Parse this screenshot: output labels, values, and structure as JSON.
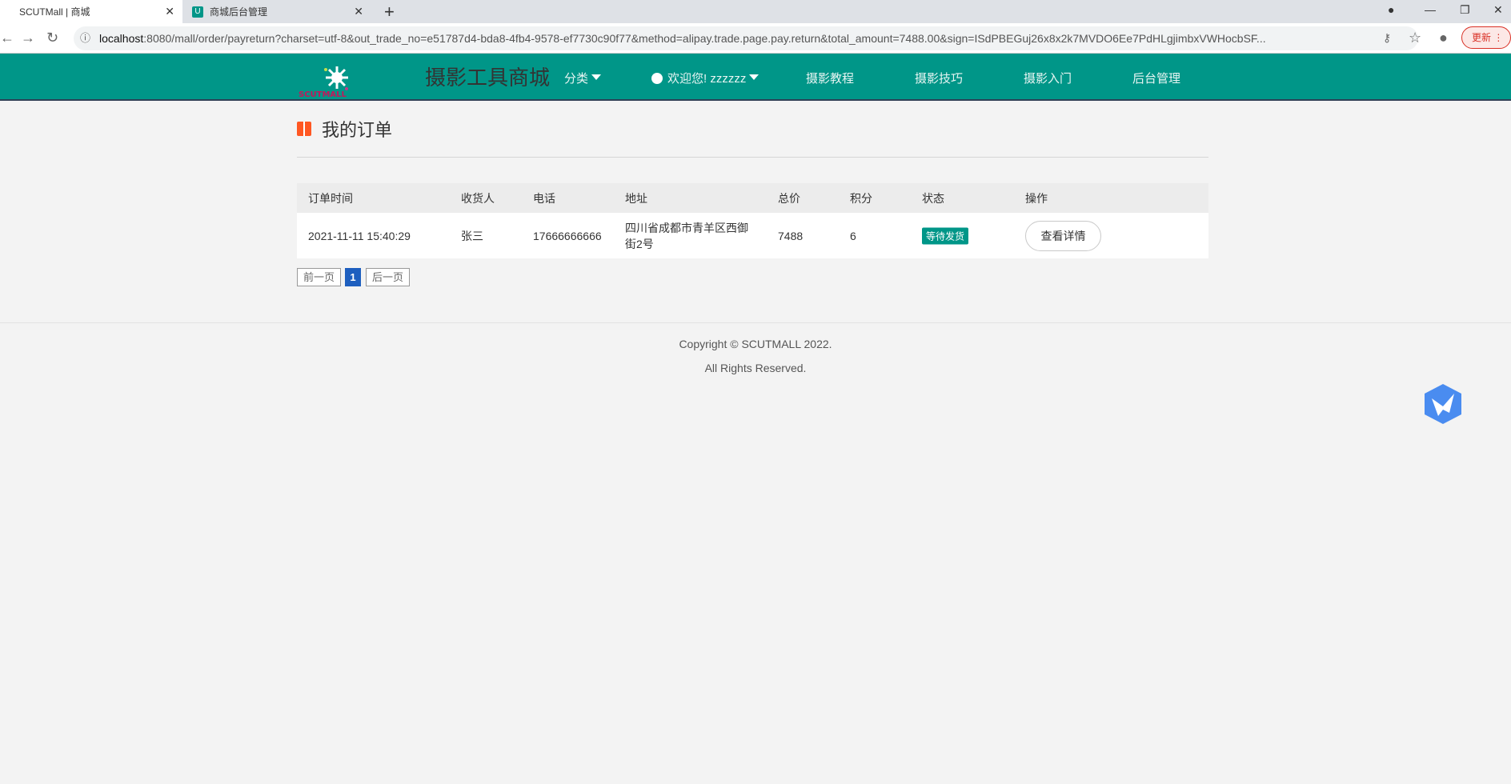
{
  "browser": {
    "tabs": [
      {
        "label": "SCUTMall | 商城",
        "close": "✕"
      },
      {
        "label": "商城后台管理",
        "close": "✕",
        "favicon": "U"
      }
    ],
    "new_tab": "+",
    "url_host": "localhost",
    "url_rest": ":8080/mall/order/payreturn?charset=utf-8&out_trade_no=e51787d4-bda8-4fb4-9578-ef7730c90f77&method=alipay.trade.page.pay.return&total_amount=7488.00&sign=ISdPBEGuj26x8x2k7MVDO6Ee7PdHLgjimbxVWHocbSF...",
    "update_label": "更新"
  },
  "header": {
    "logo_text": "SCUTMALL",
    "site_title": "摄影工具商城",
    "category": "分类",
    "welcome": "欢迎您! zzzzzz",
    "nav": [
      "摄影教程",
      "摄影技巧",
      "摄影入门",
      "后台管理"
    ]
  },
  "main": {
    "title": "我的订单",
    "columns": [
      "订单时间",
      "收货人",
      "电话",
      "地址",
      "总价",
      "积分",
      "状态",
      "操作"
    ],
    "rows": [
      {
        "time": "2021-11-11 15:40:29",
        "receiver": "张三",
        "phone": "17666666666",
        "address": "四川省成都市青羊区西御街2号",
        "total": "7488",
        "points": "6",
        "status": "等待发货",
        "action": "查看详情"
      }
    ],
    "pagination": {
      "prev": "前一页",
      "current": "1",
      "next": "后一页"
    }
  },
  "footer": {
    "copyright": "Copyright © SCUTMALL 2022.",
    "rights": "All Rights Reserved."
  },
  "colors": {
    "primary": "#009688",
    "accent": "#ff5722",
    "page_active": "#1e5fbf"
  }
}
